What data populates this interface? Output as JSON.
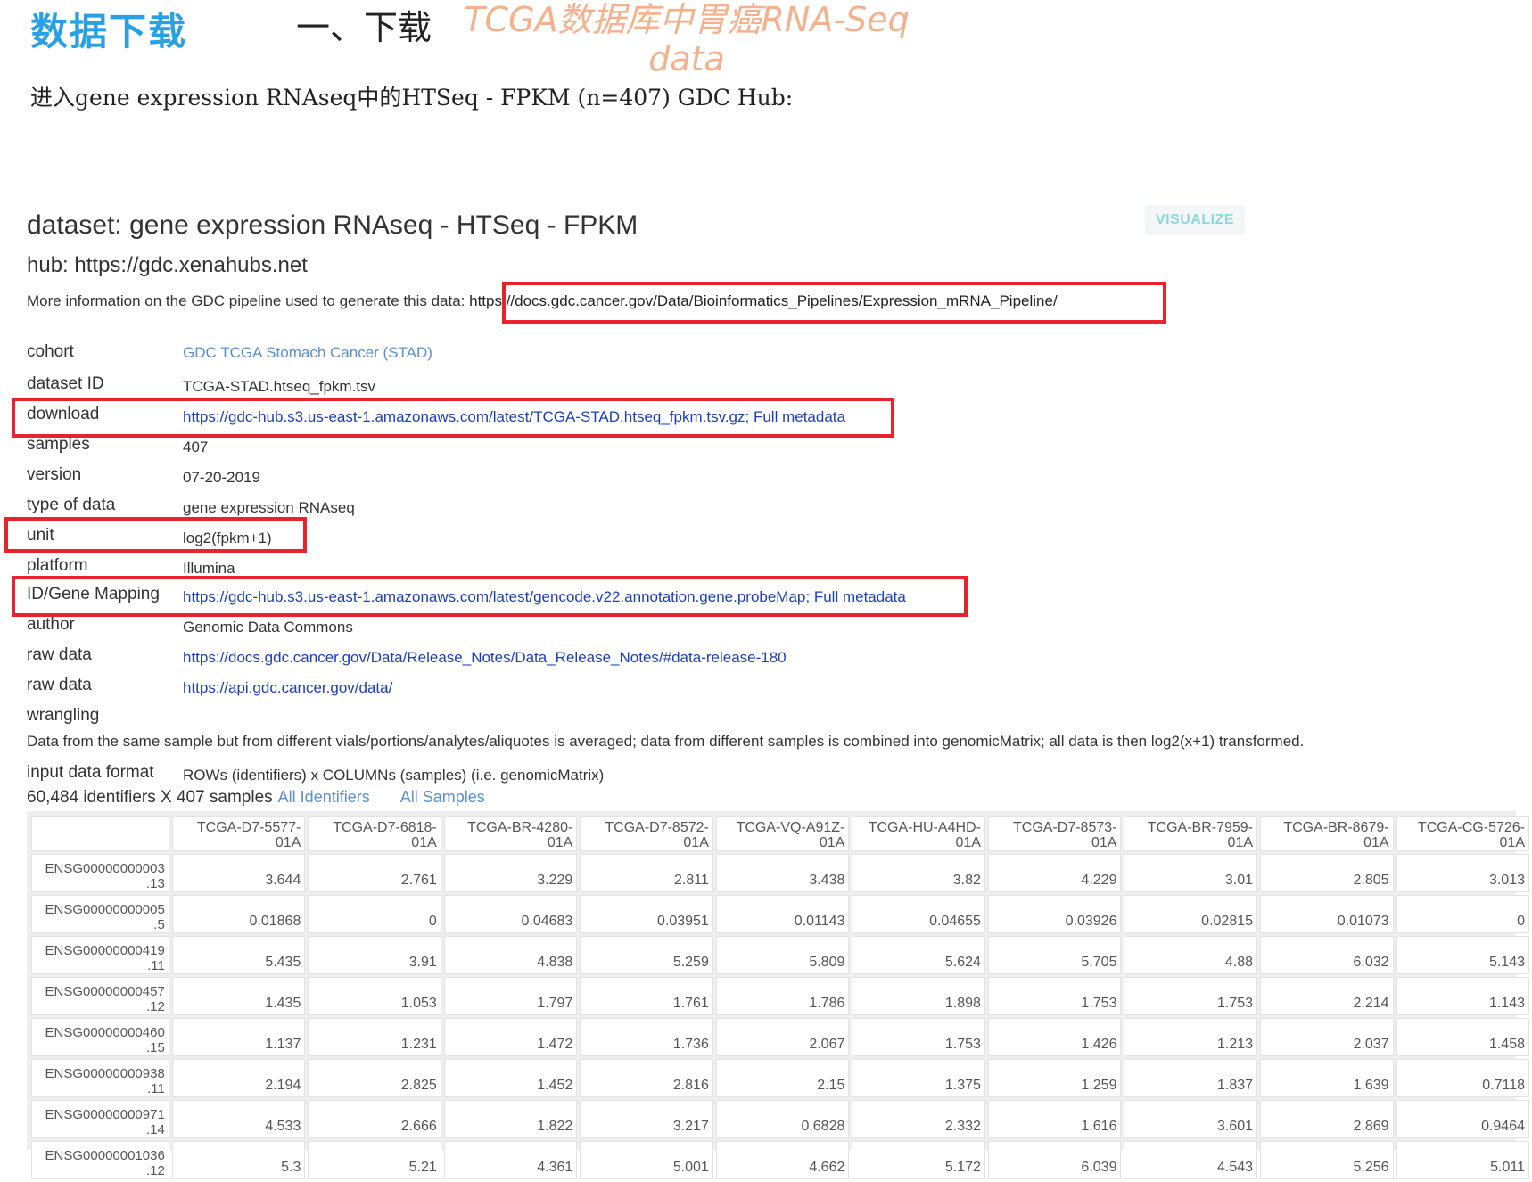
{
  "slide": {
    "section_title": "数据下载",
    "heading_prefix": "一、下载",
    "heading_highlight_line1": "TCGA数据库中胃癌RNA-Seq",
    "heading_highlight_line2": "data",
    "intro": "进入gene expression RNAseq中的HTSeq - FPKM (n=407) GDC Hub:"
  },
  "colors": {
    "section_title": "#27a0e6",
    "highlight": "#f5b08c",
    "annotation_box": "#e8232c",
    "link": "#1b3fb8",
    "light_link": "#5b8fd0"
  },
  "dataset": {
    "title": "dataset: gene expression RNAseq - HTSeq - FPKM",
    "hub": "hub: https://gdc.xenahubs.net",
    "visualize_label": "VISUALIZE",
    "more_info_text": "More information on the GDC pipeline used to generate this data: ",
    "more_info_link": "https://docs.gdc.cancer.gov/Data/Bioinformatics_Pipelines/Expression_mRNA_Pipeline/",
    "rows": {
      "cohort": {
        "label": "cohort",
        "value": "GDC TCGA Stomach Cancer (STAD)"
      },
      "dataset_id": {
        "label": "dataset ID",
        "value": "TCGA-STAD.htseq_fpkm.tsv"
      },
      "download": {
        "label": "download",
        "value": "https://gdc-hub.s3.us-east-1.amazonaws.com/latest/TCGA-STAD.htseq_fpkm.tsv.gz",
        "extra": "; Full metadata"
      },
      "samples": {
        "label": "samples",
        "value": "407"
      },
      "version": {
        "label": "version",
        "value": "07-20-2019"
      },
      "type_of_data": {
        "label": "type of data",
        "value": "gene expression RNAseq"
      },
      "unit": {
        "label": "unit",
        "value": "log2(fpkm+1)"
      },
      "platform": {
        "label": "platform",
        "value": "Illumina"
      },
      "id_gene_mapping": {
        "label": "ID/Gene Mapping",
        "value": "https://gdc-hub.s3.us-east-1.amazonaws.com/latest/gencode.v22.annotation.gene.probeMap",
        "extra": "; Full metadata"
      },
      "author": {
        "label": "author",
        "value": "Genomic Data Commons"
      },
      "raw_data_1": {
        "label": "raw data",
        "value": "https://docs.gdc.cancer.gov/Data/Release_Notes/Data_Release_Notes/#data-release-180"
      },
      "raw_data_2": {
        "label": "raw data",
        "value": "https://api.gdc.cancer.gov/data/"
      },
      "wrangling": {
        "label": "wrangling",
        "value": "Data from the same sample but from different vials/portions/analytes/aliquotes is averaged; data from different samples is combined into genomicMatrix; all data is then log2(x+1) transformed."
      },
      "input_format": {
        "label": "input data format",
        "value": "ROWs (identifiers) x COLUMNs (samples) (i.e. genomicMatrix)"
      }
    },
    "identifiers_summary": "60,484 identifiers X 407 samples",
    "all_identifiers": "All Identifiers",
    "all_samples": "All Samples"
  },
  "matrix": {
    "columns": [
      [
        "TCGA-D7-5577-",
        "01A"
      ],
      [
        "TCGA-D7-6818-",
        "01A"
      ],
      [
        "TCGA-BR-4280-",
        "01A"
      ],
      [
        "TCGA-D7-8572-",
        "01A"
      ],
      [
        "TCGA-VQ-A91Z-",
        "01A"
      ],
      [
        "TCGA-HU-A4HD-",
        "01A"
      ],
      [
        "TCGA-D7-8573-",
        "01A"
      ],
      [
        "TCGA-BR-7959-",
        "01A"
      ],
      [
        "TCGA-BR-8679-",
        "01A"
      ],
      [
        "TCGA-CG-5726-",
        "01A"
      ]
    ],
    "rows": [
      {
        "gene": [
          "ENSG00000000003",
          ".13"
        ],
        "values": [
          "3.644",
          "2.761",
          "3.229",
          "2.811",
          "3.438",
          "3.82",
          "4.229",
          "3.01",
          "2.805",
          "3.013"
        ]
      },
      {
        "gene": [
          "ENSG00000000005",
          ".5"
        ],
        "values": [
          "0.01868",
          "0",
          "0.04683",
          "0.03951",
          "0.01143",
          "0.04655",
          "0.03926",
          "0.02815",
          "0.01073",
          "0"
        ]
      },
      {
        "gene": [
          "ENSG00000000419",
          ".11"
        ],
        "values": [
          "5.435",
          "3.91",
          "4.838",
          "5.259",
          "5.809",
          "5.624",
          "5.705",
          "4.88",
          "6.032",
          "5.143"
        ]
      },
      {
        "gene": [
          "ENSG00000000457",
          ".12"
        ],
        "values": [
          "1.435",
          "1.053",
          "1.797",
          "1.761",
          "1.786",
          "1.898",
          "1.753",
          "1.753",
          "2.214",
          "1.143"
        ]
      },
      {
        "gene": [
          "ENSG00000000460",
          ".15"
        ],
        "values": [
          "1.137",
          "1.231",
          "1.472",
          "1.736",
          "2.067",
          "1.753",
          "1.426",
          "1.213",
          "2.037",
          "1.458"
        ]
      },
      {
        "gene": [
          "ENSG00000000938",
          ".11"
        ],
        "values": [
          "2.194",
          "2.825",
          "1.452",
          "2.816",
          "2.15",
          "1.375",
          "1.259",
          "1.837",
          "1.639",
          "0.7118"
        ]
      },
      {
        "gene": [
          "ENSG00000000971",
          ".14"
        ],
        "values": [
          "4.533",
          "2.666",
          "1.822",
          "3.217",
          "0.6828",
          "2.332",
          "1.616",
          "3.601",
          "2.869",
          "0.9464"
        ]
      },
      {
        "gene": [
          "ENSG00000001036",
          ".12"
        ],
        "values": [
          "5.3",
          "5.21",
          "4.361",
          "5.001",
          "4.662",
          "5.172",
          "6.039",
          "4.543",
          "5.256",
          "5.011"
        ]
      }
    ]
  }
}
